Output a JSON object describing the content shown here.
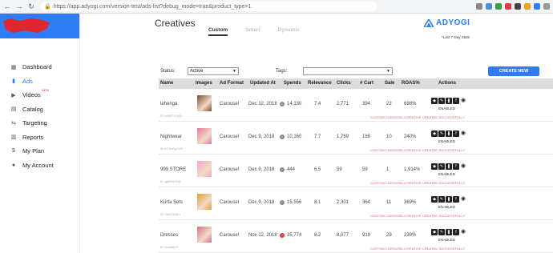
{
  "browser": {
    "url": "https://app.adyogi.com/version-test/ads-list?debug_mode=true&product_type=1"
  },
  "sidebar": {
    "items": [
      {
        "label": "Dashboard",
        "icon": "dashboard-icon",
        "glyph": "▦",
        "active": false
      },
      {
        "label": "Ads",
        "icon": "ads-icon",
        "glyph": "▮",
        "active": true
      },
      {
        "label": "Videos",
        "icon": "video-icon",
        "glyph": "▶",
        "active": false,
        "badge": "NEW"
      },
      {
        "label": "Catalog",
        "icon": "catalog-icon",
        "glyph": "▤",
        "active": false
      },
      {
        "label": "Targeting",
        "icon": "targeting-icon",
        "glyph": "⇆",
        "active": false
      },
      {
        "label": "Reports",
        "icon": "reports-icon",
        "glyph": "▥",
        "active": false
      },
      {
        "label": "My Plan",
        "icon": "plan-icon",
        "glyph": "$",
        "active": false
      },
      {
        "label": "My Account",
        "icon": "account-icon",
        "glyph": "●",
        "active": false
      }
    ]
  },
  "header": {
    "title": "Creatives",
    "tabs": [
      "Custom",
      "Smart",
      "Dynamic"
    ],
    "logo": "ADYOGI",
    "stats_note": "*Last 7-Day Stats"
  },
  "filters": {
    "status_label": "Status:",
    "status_value": "Active",
    "tags_label": "Tags:",
    "tags_value": "",
    "create_button": "CREATE NEW"
  },
  "table": {
    "headers": [
      "Name",
      "Images",
      "Ad Format",
      "Updated At",
      "Spends",
      "Relevance",
      "Clicks",
      "# Cart",
      "Sale",
      "ROAS%",
      "Actions"
    ],
    "rows": [
      {
        "name": "lehenga",
        "id": "ID: m9kBTDJvQb",
        "format": "Carousel",
        "updated": "Dec 12, 2018",
        "spends": "14,130",
        "relevance": "7.4",
        "clicks": "2,771",
        "cart": "394",
        "sale": "22",
        "roas": "698%",
        "status": "ENABLED",
        "message": "CUSTOM CAROUSEL/CREATIVE CREATED SUCCESSFULLY",
        "warn": false,
        "thumb": "#7a4a2c"
      },
      {
        "name": "Nightwear",
        "id": "ID: KTGmGgJV9P",
        "format": "Carousel",
        "updated": "Dec 9, 2018",
        "spends": "10,160",
        "relevance": "7.7",
        "clicks": "1,769",
        "cart": "188",
        "sale": "10",
        "roas": "240%",
        "status": "ENABLED",
        "message": "CUSTOM CAROUSEL/CREATIVE CREATED SUCCESSFULLY",
        "warn": false,
        "thumb": "#e27aa0"
      },
      {
        "name": "999 STORE",
        "id": "ID: gg9BDbYlMf",
        "format": "Carousel",
        "updated": "Dec 9, 2018",
        "spends": "444",
        "relevance": "6.5",
        "clicks": "59",
        "cart": "59",
        "sale": "1",
        "roas": "1,914%",
        "status": "ENABLED",
        "message": "CUSTOM CAROUSEL/CREATIVE CREATED SUCCESSFULLY",
        "warn": false,
        "thumb": "#f4a7c4"
      },
      {
        "name": "Kurta Sets",
        "id": "ID: 1xkKUdJeKt",
        "format": "Carousel",
        "updated": "Dec 9, 2018",
        "spends": "15,556",
        "relevance": "8.1",
        "clicks": "2,301",
        "cart": "364",
        "sale": "11",
        "roas": "369%",
        "status": "ENABLED",
        "message": "CUSTOM CAROUSEL/CREATIVE CREATED SUCCESSFULLY",
        "warn": false,
        "thumb": "#e0a030"
      },
      {
        "name": "Dresses",
        "id": "ID: txlzqwMU7",
        "format": "Carousel",
        "updated": "Nov 12, 2018",
        "spends": "35,774",
        "relevance": "8.2",
        "clicks": "8,077",
        "cart": "919",
        "sale": "29",
        "roas": "239%",
        "status": "ENABLED",
        "message": "CUSTOM CAROUSEL/CREATIVE CREATED SUCCESSFULLY",
        "warn": true,
        "thumb": "#d9708a"
      }
    ]
  },
  "colors": {
    "brand": "#2f7cf6",
    "error": "#e85a5a",
    "redact": "#e0262f"
  }
}
